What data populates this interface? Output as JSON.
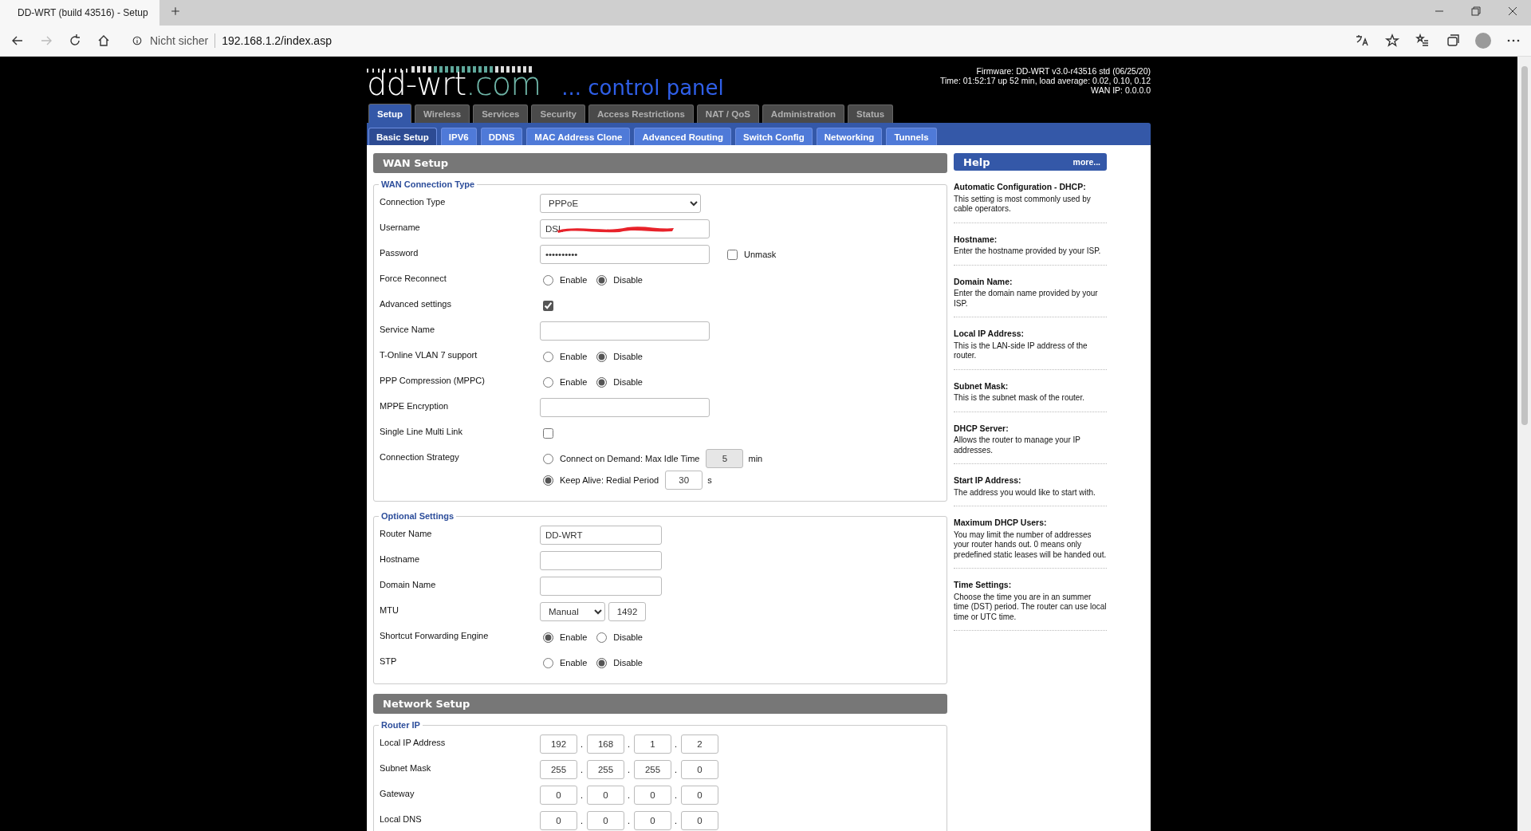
{
  "browser": {
    "tab_title": "DD-WRT (build 43516) - Setup",
    "security": "Nicht sicher",
    "url": "192.168.1.2/index.asp"
  },
  "header": {
    "logo": "dd-wrt",
    "logo_suffix": ".com",
    "tagline": "... control panel",
    "info": [
      "Firmware: DD-WRT v3.0-r43516 std (06/25/20)",
      "Time: 01:52:17 up 52 min, load average: 0.02, 0.10, 0.12",
      "WAN IP: 0.0.0.0"
    ]
  },
  "main_tabs": [
    {
      "label": "Setup",
      "selected": true
    },
    {
      "label": "Wireless",
      "selected": false
    },
    {
      "label": "Services",
      "selected": false
    },
    {
      "label": "Security",
      "selected": false
    },
    {
      "label": "Access Restrictions",
      "selected": false
    },
    {
      "label": "NAT / QoS",
      "selected": false
    },
    {
      "label": "Administration",
      "selected": false
    },
    {
      "label": "Status",
      "selected": false
    }
  ],
  "sub_tabs": [
    {
      "label": "Basic Setup",
      "selected": true
    },
    {
      "label": "IPV6",
      "selected": false
    },
    {
      "label": "DDNS",
      "selected": false
    },
    {
      "label": "MAC Address Clone",
      "selected": false
    },
    {
      "label": "Advanced Routing",
      "selected": false
    },
    {
      "label": "Switch Config",
      "selected": false
    },
    {
      "label": "Networking",
      "selected": false
    },
    {
      "label": "Tunnels",
      "selected": false
    }
  ],
  "sections": [
    {
      "title": "WAN Setup",
      "fieldsets": [
        {
          "legend": "WAN Connection Type",
          "rows": [
            {
              "kind": "select",
              "label": "Connection Type",
              "value": "PPPoE"
            },
            {
              "kind": "text",
              "label": "Username",
              "value": "DSL",
              "redacted": true
            },
            {
              "kind": "password",
              "label": "Password",
              "value": "••••••••••",
              "unmask": {
                "label": "Unmask",
                "checked": false
              }
            },
            {
              "kind": "radio",
              "label": "Force Reconnect",
              "options": [
                {
                  "label": "Enable",
                  "selected": false
                },
                {
                  "label": "Disable",
                  "selected": true
                }
              ]
            },
            {
              "kind": "checkbox",
              "label": "Advanced settings",
              "checked": true
            },
            {
              "kind": "text",
              "label": "Service Name"
            },
            {
              "kind": "radio",
              "label": "T-Online VLAN 7 support",
              "options": [
                {
                  "label": "Enable",
                  "selected": false
                },
                {
                  "label": "Disable",
                  "selected": true
                }
              ]
            },
            {
              "kind": "radio",
              "label": "PPP Compression (MPPC)",
              "options": [
                {
                  "label": "Enable",
                  "selected": false
                },
                {
                  "label": "Disable",
                  "selected": true
                }
              ]
            },
            {
              "kind": "text",
              "label": "MPPE Encryption"
            },
            {
              "kind": "checkbox",
              "label": "Single Line Multi Link",
              "checked": false
            },
            {
              "kind": "strategy",
              "label": "Connection Strategy",
              "options": [
                {
                  "label": "Connect on Demand: Max Idle Time",
                  "selected": false,
                  "value": "5",
                  "unit": "min",
                  "disabled": true
                },
                {
                  "label": "Keep Alive: Redial Period",
                  "selected": true,
                  "value": "30",
                  "unit": "s",
                  "disabled": false
                }
              ]
            }
          ]
        },
        {
          "legend": "Optional Settings",
          "rows": [
            {
              "kind": "short_text",
              "label": "Router Name",
              "value": "DD-WRT"
            },
            {
              "kind": "short_text",
              "label": "Hostname"
            },
            {
              "kind": "short_text",
              "label": "Domain Name"
            },
            {
              "kind": "mtu",
              "label": "MTU",
              "select": "Manual",
              "value": "1492"
            },
            {
              "kind": "radio",
              "label": "Shortcut Forwarding Engine",
              "options": [
                {
                  "label": "Enable",
                  "selected": true
                },
                {
                  "label": "Disable",
                  "selected": false
                }
              ]
            },
            {
              "kind": "radio",
              "label": "STP",
              "options": [
                {
                  "label": "Enable",
                  "selected": false
                },
                {
                  "label": "Disable",
                  "selected": true
                }
              ]
            }
          ]
        }
      ]
    },
    {
      "title": "Network Setup",
      "fieldsets": [
        {
          "legend": "Router IP",
          "rows": [
            {
              "kind": "ip",
              "label": "Local IP Address",
              "octets": [
                "192",
                "168",
                "1",
                "2"
              ],
              "separators": [
                ".",
                ".",
                "."
              ]
            },
            {
              "kind": "ip",
              "label": "Subnet Mask",
              "octets": [
                "255",
                "255",
                "255",
                "0"
              ],
              "separators": [
                ".",
                ".",
                "."
              ]
            },
            {
              "kind": "ip",
              "label": "Gateway",
              "octets": [
                "0",
                "0",
                "0",
                "0"
              ],
              "separators": [
                ".",
                ".",
                "."
              ]
            },
            {
              "kind": "ip",
              "label": "Local DNS",
              "octets": [
                "0",
                "0",
                "0",
                "0"
              ],
              "separators": [
                ".",
                ".",
                "."
              ]
            }
          ]
        }
      ]
    }
  ],
  "help": {
    "title": "Help",
    "more": "more...",
    "items": [
      {
        "title": "Automatic Configuration - DHCP:",
        "text": "This setting is most commonly used by cable operators."
      },
      {
        "title": "Hostname:",
        "text": "Enter the hostname provided by your ISP."
      },
      {
        "title": "Domain Name:",
        "text": "Enter the domain name provided by your ISP."
      },
      {
        "title": "Local IP Address:",
        "text": "This is the LAN-side IP address of the router."
      },
      {
        "title": "Subnet Mask:",
        "text": "This is the subnet mask of the router."
      },
      {
        "title": "DHCP Server:",
        "text": "Allows the router to manage your IP addresses."
      },
      {
        "title": "Start IP Address:",
        "text": "The address you would like to start with."
      },
      {
        "title": "Maximum DHCP Users:",
        "text": "You may limit the number of addresses your router hands out. 0 means only predefined static leases will be handed out."
      },
      {
        "title": "Time Settings:",
        "text": "Choose the time you are in an summer time (DST) period. The router can use local time or UTC time."
      }
    ]
  }
}
